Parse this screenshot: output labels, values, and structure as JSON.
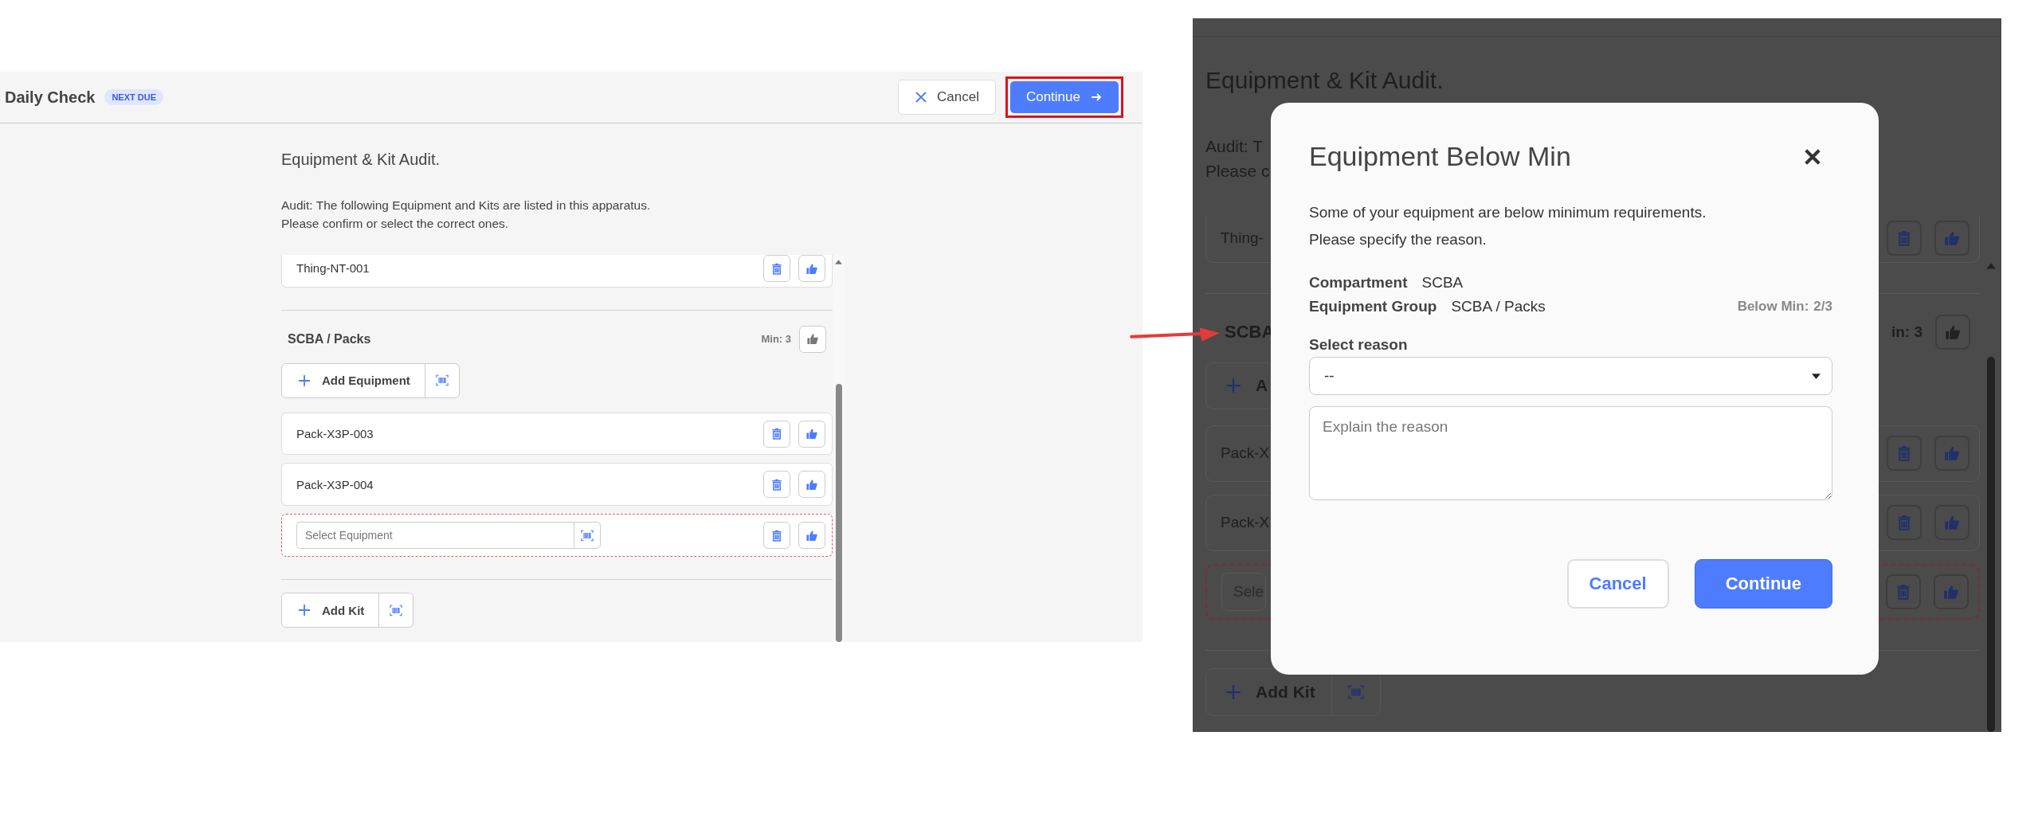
{
  "main_screen": {
    "header": {
      "title": "Daily Check",
      "badge": "NEXT DUE",
      "cancel": "Cancel",
      "continue": "Continue",
      "continue_highlighted": true
    },
    "section_title": "Equipment & Kit Audit.",
    "intro": [
      "Audit: The following Equipment and Kits are listed in this apparatus.",
      "Please confirm or select the correct ones."
    ],
    "top_item": "Thing-NT-001",
    "group": {
      "name": "SCBA / Packs",
      "min": "Min: 3",
      "confirmed": false,
      "add_button": "Add Equipment",
      "items": [
        {
          "kind": "equipment",
          "name": "Pack-X3P-003"
        },
        {
          "kind": "equipment",
          "name": "Pack-X3P-004"
        },
        {
          "kind": "select",
          "placeholder": "Select Equipment",
          "invalid": true
        }
      ]
    },
    "add_kit": "Add Kit"
  },
  "dialog_screen": {
    "background": {
      "title": "Equipment & Kit Audit.",
      "intro": [
        "Audit: T",
        "Please c"
      ],
      "top_item": "Thing-",
      "group_name": "SCBA",
      "min": "in: 3",
      "add_button": "A",
      "items": [
        {
          "kind": "equipment",
          "name": "Pack-X"
        },
        {
          "kind": "equipment",
          "name": "Pack-X"
        },
        {
          "kind": "select",
          "placeholder": "Sele",
          "invalid": true
        }
      ],
      "add_kit": "Add Kit"
    },
    "dialog": {
      "title": "Equipment Below Min",
      "message": [
        "Some of your equipment are below minimum requirements.",
        "Please specify the reason."
      ],
      "fields": [
        {
          "label": "Compartment",
          "value": "SCBA"
        },
        {
          "label": "Equipment Group",
          "value": "SCBA / Packs"
        }
      ],
      "below_min_label": "Below Min:",
      "below_min_value": "2/3",
      "reason_label": "Select reason",
      "reason_value": "--",
      "explain_placeholder": "Explain the reason",
      "cancel": "Cancel",
      "continue": "Continue"
    }
  }
}
